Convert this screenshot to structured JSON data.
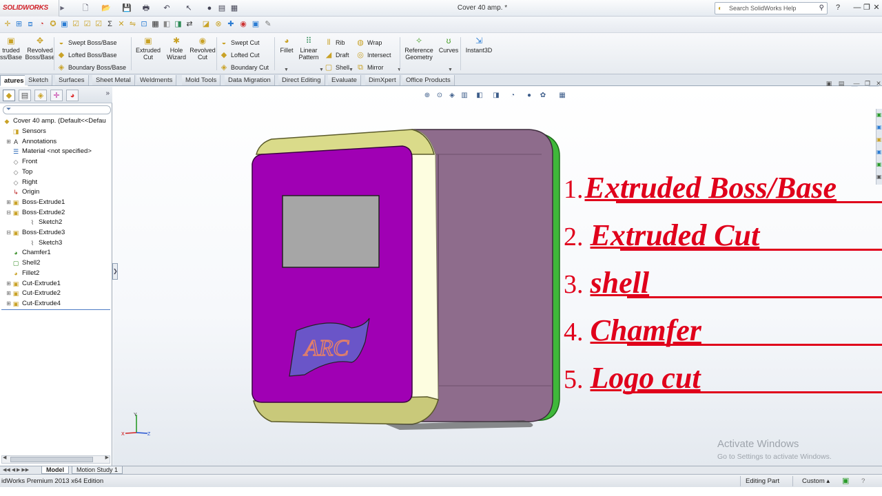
{
  "app": {
    "logo": "SOLIDWORKS",
    "doc_title": "Cover 40  amp. *",
    "help_placeholder": "Search SolidWorks Help",
    "quick_access": [
      {
        "icon": "new-icon",
        "glyph": "🗋"
      },
      {
        "icon": "open-icon",
        "glyph": "📂"
      },
      {
        "icon": "save-icon",
        "glyph": "💾"
      },
      {
        "icon": "print-icon",
        "glyph": "🖶"
      },
      {
        "icon": "undo-icon",
        "glyph": "↶"
      },
      {
        "icon": "select-icon",
        "glyph": "↖"
      },
      {
        "icon": "traffic-light-icon",
        "glyph": "●"
      },
      {
        "icon": "file-properties-icon",
        "glyph": "▤"
      },
      {
        "icon": "options-icon",
        "glyph": "▦"
      }
    ],
    "window_buttons": [
      "?",
      "—",
      "❐",
      "✕"
    ]
  },
  "command_manager": {
    "big": [
      {
        "id": "extruded-boss",
        "label": "truded\nss/Base",
        "icon": "extruded-boss-icon",
        "glyph": "▣",
        "color": "#c9a227"
      },
      {
        "id": "revolved-boss",
        "label": "Revolved\nBoss/Base",
        "icon": "revolved-boss-icon",
        "glyph": "✥",
        "color": "#c9a227"
      },
      {
        "id": "extruded-cut",
        "label": "Extruded\nCut",
        "icon": "extruded-cut-icon",
        "glyph": "▣",
        "color": "#c9a227"
      },
      {
        "id": "hole-wizard",
        "label": "Hole\nWizard",
        "icon": "hole-wizard-icon",
        "glyph": "✱",
        "color": "#c9a227"
      },
      {
        "id": "revolved-cut",
        "label": "Revolved\nCut",
        "icon": "revolved-cut-icon",
        "glyph": "◉",
        "color": "#c9a227"
      },
      {
        "id": "fillet",
        "label": "Fillet",
        "icon": "fillet-icon",
        "glyph": "◕",
        "color": "#c9a227"
      },
      {
        "id": "linear-pattern",
        "label": "Linear\nPattern",
        "icon": "linear-pattern-icon",
        "glyph": "⠿",
        "color": "#2e8b57"
      },
      {
        "id": "reference-geometry",
        "label": "Reference\nGeometry",
        "icon": "reference-geometry-icon",
        "glyph": "✧",
        "color": "#4aa02c"
      },
      {
        "id": "curves",
        "label": "Curves",
        "icon": "curves-icon",
        "glyph": "ʊ",
        "color": "#4aa02c"
      },
      {
        "id": "instant3d",
        "label": "Instant3D",
        "icon": "instant3d-icon",
        "glyph": "⇲",
        "color": "#2b7cd3"
      }
    ],
    "small": [
      {
        "id": "swept-boss",
        "label": "Swept Boss/Base",
        "icon": "swept-boss-icon",
        "glyph": "◒"
      },
      {
        "id": "lofted-boss",
        "label": "Lofted Boss/Base",
        "icon": "lofted-boss-icon",
        "glyph": "◆"
      },
      {
        "id": "boundary-boss",
        "label": "Boundary Boss/Base",
        "icon": "boundary-boss-icon",
        "glyph": "◈"
      },
      {
        "id": "swept-cut",
        "label": "Swept Cut",
        "icon": "swept-cut-icon",
        "glyph": "◒"
      },
      {
        "id": "lofted-cut",
        "label": "Lofted Cut",
        "icon": "lofted-cut-icon",
        "glyph": "◆"
      },
      {
        "id": "boundary-cut",
        "label": "Boundary Cut",
        "icon": "boundary-cut-icon",
        "glyph": "◈"
      },
      {
        "id": "rib",
        "label": "Rib",
        "icon": "rib-icon",
        "glyph": "⫴"
      },
      {
        "id": "draft",
        "label": "Draft",
        "icon": "draft-icon",
        "glyph": "◢"
      },
      {
        "id": "shell",
        "label": "Shell",
        "icon": "shell-icon",
        "glyph": "▢"
      },
      {
        "id": "wrap",
        "label": "Wrap",
        "icon": "wrap-icon",
        "glyph": "◍"
      },
      {
        "id": "intersect",
        "label": "Intersect",
        "icon": "intersect-icon",
        "glyph": "◎"
      },
      {
        "id": "mirror",
        "label": "Mirror",
        "icon": "mirror-icon",
        "glyph": "⧉"
      }
    ]
  },
  "tabs": [
    "atures",
    "Sketch",
    "Surfaces",
    "Sheet Metal",
    "Weldments",
    "Mold Tools",
    "Data Migration",
    "Direct Editing",
    "Evaluate",
    "DimXpert",
    "Office Products"
  ],
  "tree": {
    "root": "Cover 40  amp.  (Default<<Defau",
    "items": [
      {
        "label": "Sensors",
        "icon": "sensors-icon",
        "glyph": "◨",
        "color": "#c9a227",
        "exp": ""
      },
      {
        "label": "Annotations",
        "icon": "annotations-icon",
        "glyph": "A",
        "color": "#333",
        "exp": "+"
      },
      {
        "label": "Material <not specified>",
        "icon": "material-icon",
        "glyph": "☰",
        "color": "#1e5fb3",
        "exp": ""
      },
      {
        "label": "Front",
        "icon": "plane-icon",
        "glyph": "◇",
        "color": "#666",
        "exp": ""
      },
      {
        "label": "Top",
        "icon": "plane-icon",
        "glyph": "◇",
        "color": "#666",
        "exp": ""
      },
      {
        "label": "Right",
        "icon": "plane-icon",
        "glyph": "◇",
        "color": "#666",
        "exp": ""
      },
      {
        "label": "Origin",
        "icon": "origin-icon",
        "glyph": "↳",
        "color": "#b22",
        "exp": ""
      },
      {
        "label": "Boss-Extrude1",
        "icon": "extrude-feature-icon",
        "glyph": "▣",
        "color": "#c9a227",
        "exp": "+"
      },
      {
        "label": "Boss-Extrude2",
        "icon": "extrude-feature-icon",
        "glyph": "▣",
        "color": "#c9a227",
        "exp": "−"
      },
      {
        "label": "Sketch2",
        "icon": "sketch-icon",
        "glyph": "⌇",
        "color": "#555",
        "exp": "",
        "indent": 1
      },
      {
        "label": "Boss-Extrude3",
        "icon": "extrude-feature-icon",
        "glyph": "▣",
        "color": "#c9a227",
        "exp": "−"
      },
      {
        "label": "Sketch3",
        "icon": "sketch-icon",
        "glyph": "⌇",
        "color": "#555",
        "exp": "",
        "indent": 1
      },
      {
        "label": "Chamfer1",
        "icon": "chamfer-icon",
        "glyph": "◕",
        "color": "#3a8f2a",
        "exp": ""
      },
      {
        "label": "Shell2",
        "icon": "shell-feature-icon",
        "glyph": "▢",
        "color": "#3a8f2a",
        "exp": ""
      },
      {
        "label": "Fillet2",
        "icon": "fillet-feature-icon",
        "glyph": "◕",
        "color": "#c9a227",
        "exp": ""
      },
      {
        "label": "Cut-Extrude1",
        "icon": "cut-extrude-icon",
        "glyph": "▣",
        "color": "#c9a227",
        "exp": "+"
      },
      {
        "label": "Cut-Extrude2",
        "icon": "cut-extrude-icon",
        "glyph": "▣",
        "color": "#c9a227",
        "exp": "+"
      },
      {
        "label": "Cut-Extrude4",
        "icon": "cut-extrude-icon",
        "glyph": "▣",
        "color": "#c9a227",
        "exp": "+"
      }
    ]
  },
  "annotations": [
    {
      "num": "1.",
      "text": "Extruded Boss/Base"
    },
    {
      "num": "2.",
      "text": "Extruded Cut"
    },
    {
      "num": "3.",
      "text": "shell"
    },
    {
      "num": "4.",
      "text": "Chamfer"
    },
    {
      "num": "5.",
      "text": "Logo cut"
    }
  ],
  "model": {
    "logo_text": "ARC",
    "colors": {
      "front": "#a000b4",
      "side": "#8e6c8c",
      "bevel": "#dadb8a",
      "green": "#3fb83a",
      "screen": "#a6a6a6",
      "logo": "#6a55c8"
    }
  },
  "triad": {
    "x": "X",
    "y": "Y",
    "z": "Z"
  },
  "watermark": {
    "line1": "Activate Windows",
    "line2": "Go to Settings to activate Windows."
  },
  "bottom_tabs": [
    "Model",
    "Motion Study 1"
  ],
  "status": {
    "edition": "idWorks Premium 2013 x64 Edition",
    "mode": "Editing Part",
    "units": "Custom"
  }
}
